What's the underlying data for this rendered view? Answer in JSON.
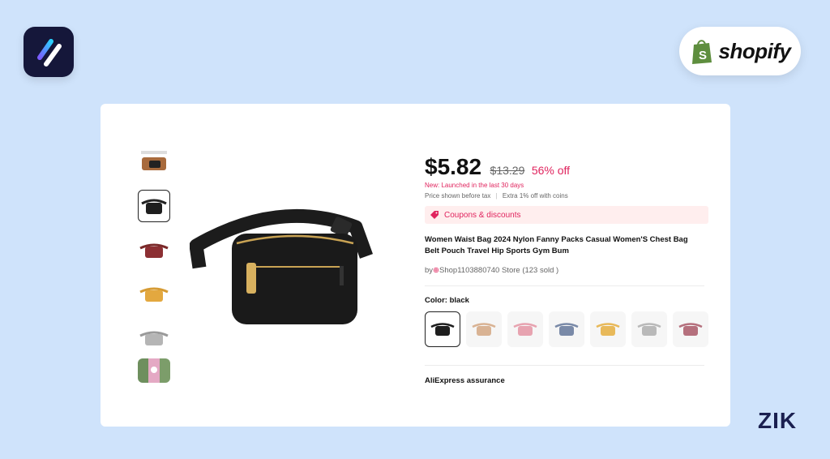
{
  "branding": {
    "shopify_label": "shopify",
    "watermark": "ZIK"
  },
  "product": {
    "price": "$5.82",
    "original_price": "$13.29",
    "discount": "56% off",
    "new_launch": "New: Launched in the last 30 days",
    "price_note": "Price shown before tax",
    "coins_note": "Extra 1% off with coins",
    "coupon_label": "Coupons & discounts",
    "title": "Women Waist Bag 2024 Nylon Fanny Packs Casual Women'S Chest Bag Belt Pouch Travel Hip Sports Gym Bum",
    "store_prefix": "by",
    "store_name": "Shop1103880740 Store",
    "sold": "(123 sold )",
    "color_label": "Color: black",
    "assurance": "AliExpress assurance"
  },
  "gallery": {
    "thumbnails": [
      "package",
      "black",
      "burgundy",
      "mustard",
      "gray",
      "lifestyle"
    ],
    "selected_index": 1
  },
  "variants": {
    "colors": [
      "#1e1e1e",
      "#d9b394",
      "#e7a3b0",
      "#7a8aa8",
      "#e8b95a",
      "#b9b9b9",
      "#b5707d"
    ],
    "selected_index": 0
  },
  "colors": {
    "accent": "#e0245e",
    "coupon_bg": "#ffeeee",
    "page_bg": "#cfe3fb",
    "app_logo_bg": "#15173a",
    "shopify_green": "#5e8e3e"
  }
}
